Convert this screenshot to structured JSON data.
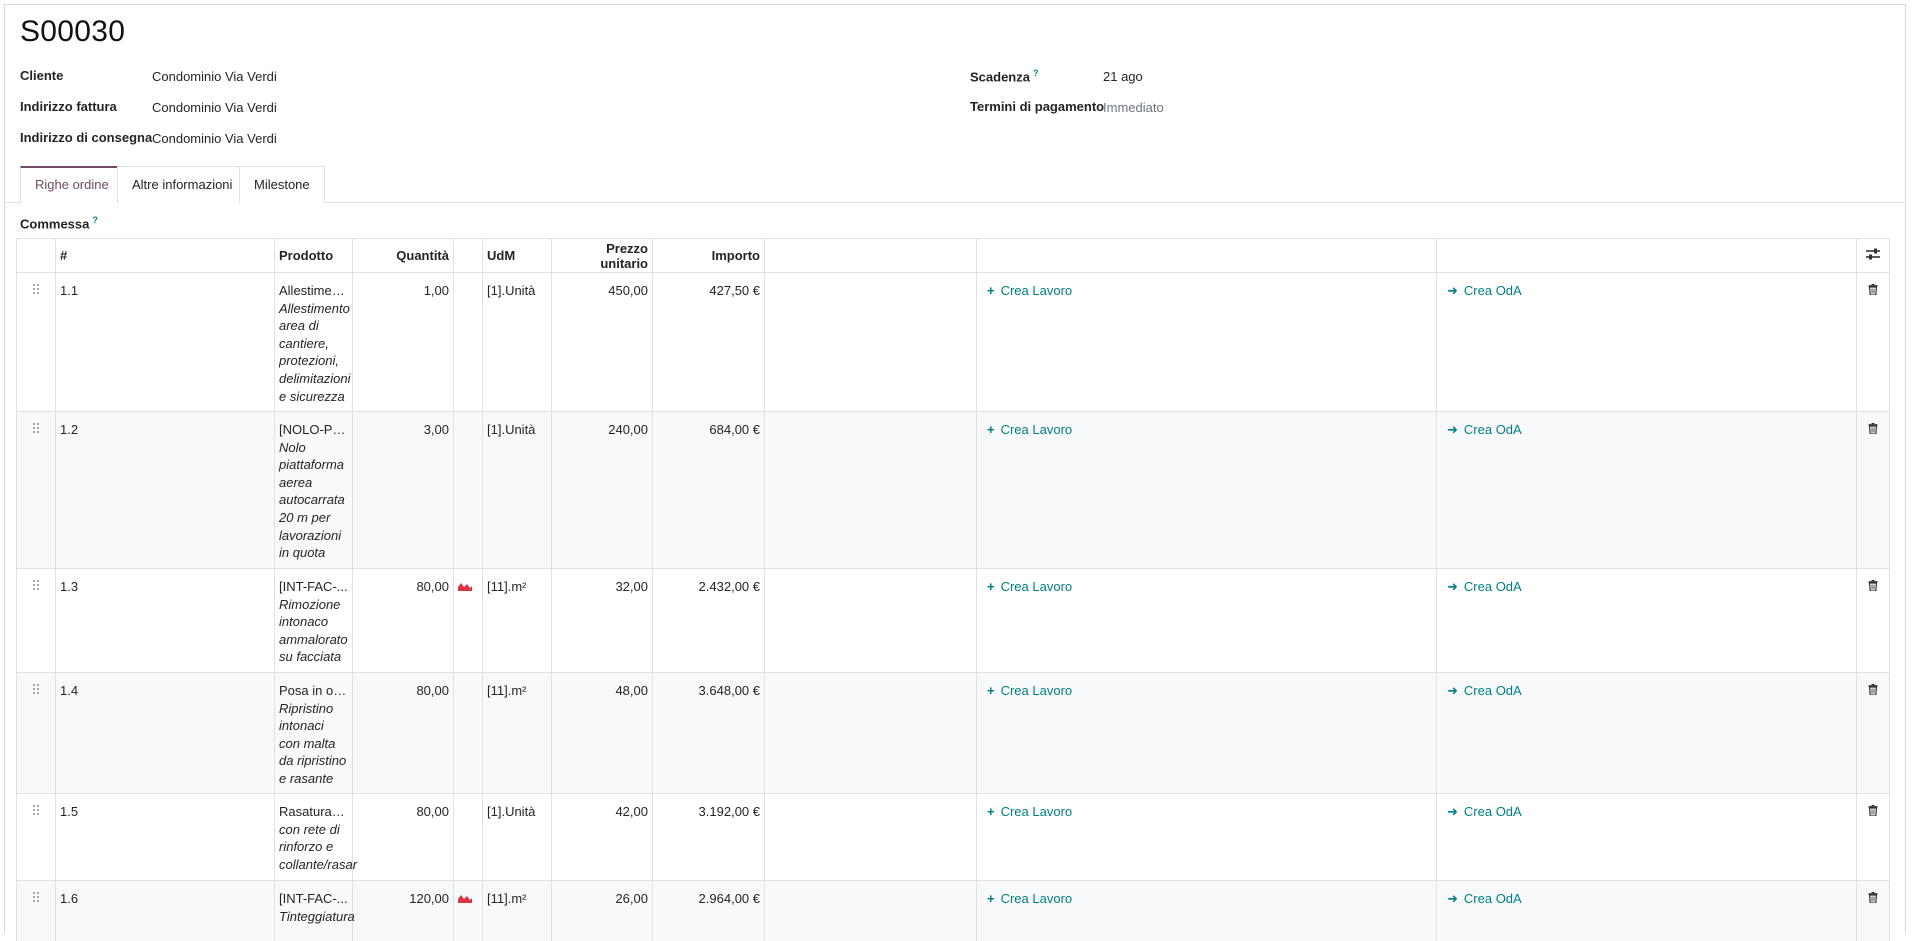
{
  "record": {
    "title": "S00030"
  },
  "form": {
    "cliente_label": "Cliente",
    "cliente_value": "Condominio Via Verdi",
    "indirizzo_fattura_label": "Indirizzo fattura",
    "indirizzo_fattura_value": "Condominio Via Verdi",
    "indirizzo_consegna_label": "Indirizzo di consegna",
    "indirizzo_consegna_value": "Condominio Via Verdi",
    "scadenza_label": "Scadenza",
    "scadenza_help": "?",
    "scadenza_value": "21 ago",
    "termini_label": "Termini di pagamento",
    "termini_placeholder": "Immediato"
  },
  "tabs": [
    {
      "label": "Righe ordine",
      "active": true
    },
    {
      "label": "Altre informazioni",
      "active": false
    },
    {
      "label": "Milestone",
      "active": false
    }
  ],
  "commessa": {
    "label": "Commessa",
    "help": "?"
  },
  "table": {
    "headers": {
      "seq": "#",
      "product": "Prodotto",
      "qty": "Quantità",
      "uom": "UdM",
      "price": "Prezzo unitario",
      "amount": "Importo"
    },
    "rows": [
      {
        "seq": "1.1",
        "product": "Allestiment...",
        "description": "Allestimento area di cantiere, protezioni, delimitazioni e sicurezza",
        "qty": "1,00",
        "forecast": false,
        "uom": "[1].Unità",
        "price": "450,00",
        "amount": "427,50 €",
        "work_label": "Crea Lavoro",
        "po_label": "Crea OdA"
      },
      {
        "seq": "1.2",
        "product": "[NOLO-PIA...",
        "description": "Nolo piattaforma aerea autocarrata 20 m per lavorazioni in quota",
        "qty": "3,00",
        "forecast": false,
        "uom": "[1].Unità",
        "price": "240,00",
        "amount": "684,00 €",
        "work_label": "Crea Lavoro",
        "po_label": "Crea OdA"
      },
      {
        "seq": "1.3",
        "product": "[INT-FAC-...",
        "description": "Rimozione intonaco ammalorato su facciata",
        "qty": "80,00",
        "forecast": true,
        "uom": "[11].m²",
        "price": "32,00",
        "amount": "2.432,00 €",
        "work_label": "Crea Lavoro",
        "po_label": "Crea OdA"
      },
      {
        "seq": "1.4",
        "product": "Posa in op...",
        "description": "Ripristino intonaci con malta da ripristino e rasante",
        "qty": "80,00",
        "forecast": false,
        "uom": "[11].m²",
        "price": "48,00",
        "amount": "3.648,00 €",
        "work_label": "Crea Lavoro",
        "po_label": "Crea OdA"
      },
      {
        "seq": "1.5",
        "product": "Rasatura a...",
        "description": "con rete di rinforzo e collante/rasar",
        "qty": "80,00",
        "forecast": false,
        "uom": "[1].Unità",
        "price": "42,00",
        "amount": "3.192,00 €",
        "work_label": "Crea Lavoro",
        "po_label": "Crea OdA"
      },
      {
        "seq": "1.6",
        "product": "[INT-FAC-...",
        "description": "Tinteggiatura",
        "qty": "120,00",
        "forecast": true,
        "uom": "[11].m²",
        "price": "26,00",
        "amount": "2.964,00 €",
        "work_label": "Crea Lavoro",
        "po_label": "Crea OdA"
      }
    ]
  },
  "icons": {
    "drag": "drag-handle-icon",
    "plus": "plus-icon",
    "arrow": "arrow-right-icon",
    "trash": "trash-icon",
    "forecast": "forecast-chart-icon",
    "optional_columns": "optional-columns-icon"
  },
  "colors": {
    "accent": "#017e84",
    "brand": "#714b67",
    "forecast": "#dc3545"
  }
}
